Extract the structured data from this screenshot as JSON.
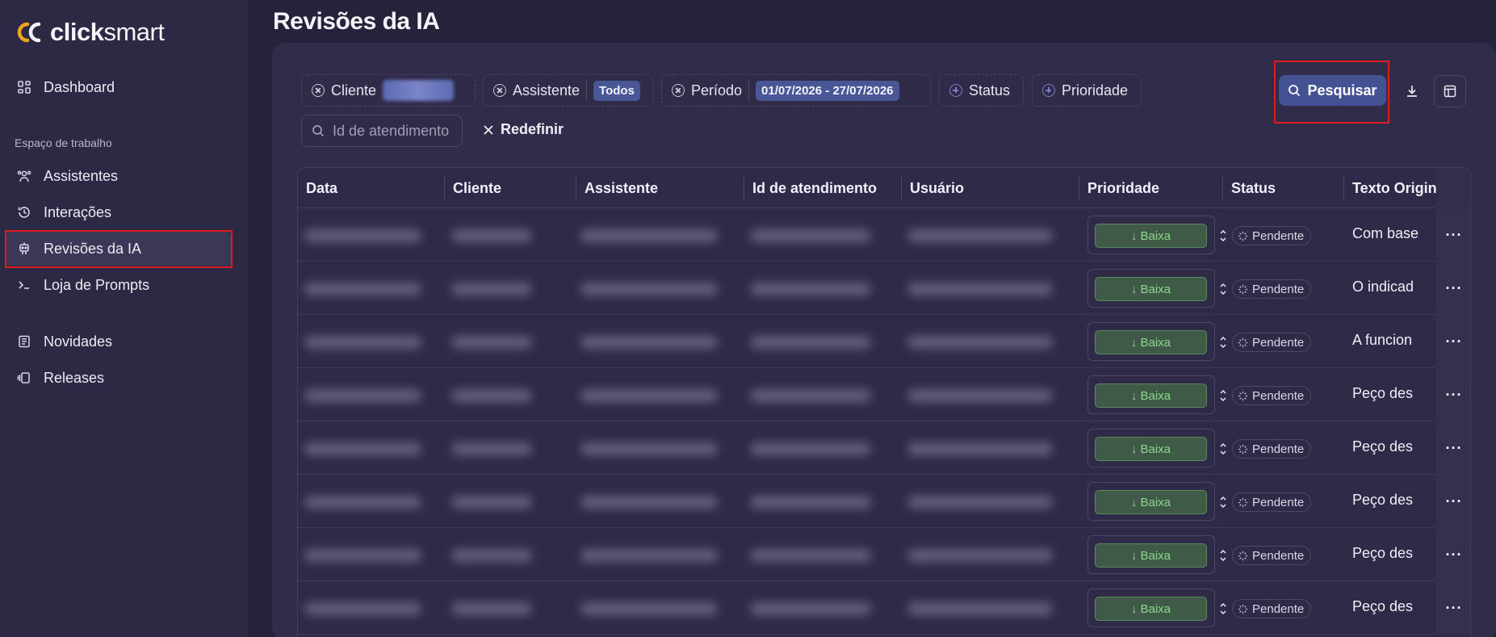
{
  "brand": {
    "text_prefix": "click",
    "text_suffix": "smart"
  },
  "sidebar": {
    "items_top": [
      {
        "label": "Dashboard",
        "icon": "dashboard-icon"
      }
    ],
    "section_label": "Espaço de trabalho",
    "items_workspace": [
      {
        "label": "Assistentes",
        "icon": "users-icon"
      },
      {
        "label": "Interações",
        "icon": "history-icon"
      },
      {
        "label": "Revisões da IA",
        "icon": "robot-icon",
        "active": true
      },
      {
        "label": "Loja de Prompts",
        "icon": "terminal-icon"
      }
    ],
    "items_bottom": [
      {
        "label": "Novidades",
        "icon": "news-icon"
      },
      {
        "label": "Releases",
        "icon": "releases-icon"
      }
    ]
  },
  "page": {
    "title": "Revisões da IA"
  },
  "filters": {
    "cliente": {
      "label": "Cliente"
    },
    "assistente": {
      "label": "Assistente",
      "value": "Todos"
    },
    "periodo": {
      "label": "Período",
      "value": "01/07/2026 - 27/07/2026"
    },
    "status": {
      "label": "Status"
    },
    "prioridade": {
      "label": "Prioridade"
    },
    "search_placeholder": "Id de atendimento",
    "reset_label": "Redefinir",
    "search_button": "Pesquisar"
  },
  "table": {
    "columns": [
      "Data",
      "Cliente",
      "Assistente",
      "Id de atendimento",
      "Usuário",
      "Prioridade",
      "Status",
      "Texto Original"
    ],
    "rows": [
      {
        "prioridade": "Baixa",
        "status": "Pendente",
        "texto": "Com base"
      },
      {
        "prioridade": "Baixa",
        "status": "Pendente",
        "texto": "O indicad"
      },
      {
        "prioridade": "Baixa",
        "status": "Pendente",
        "texto": "A funcion"
      },
      {
        "prioridade": "Baixa",
        "status": "Pendente",
        "texto": "Peço des"
      },
      {
        "prioridade": "Baixa",
        "status": "Pendente",
        "texto": "Peço des"
      },
      {
        "prioridade": "Baixa",
        "status": "Pendente",
        "texto": "Peço des"
      },
      {
        "prioridade": "Baixa",
        "status": "Pendente",
        "texto": "Peço des"
      },
      {
        "prioridade": "Baixa",
        "status": "Pendente",
        "texto": "Peço des"
      }
    ]
  },
  "colors": {
    "accent": "#445193",
    "brand_orange": "#f4a41b",
    "priority_low": "#8fd491",
    "highlight": "#e01d1d"
  }
}
